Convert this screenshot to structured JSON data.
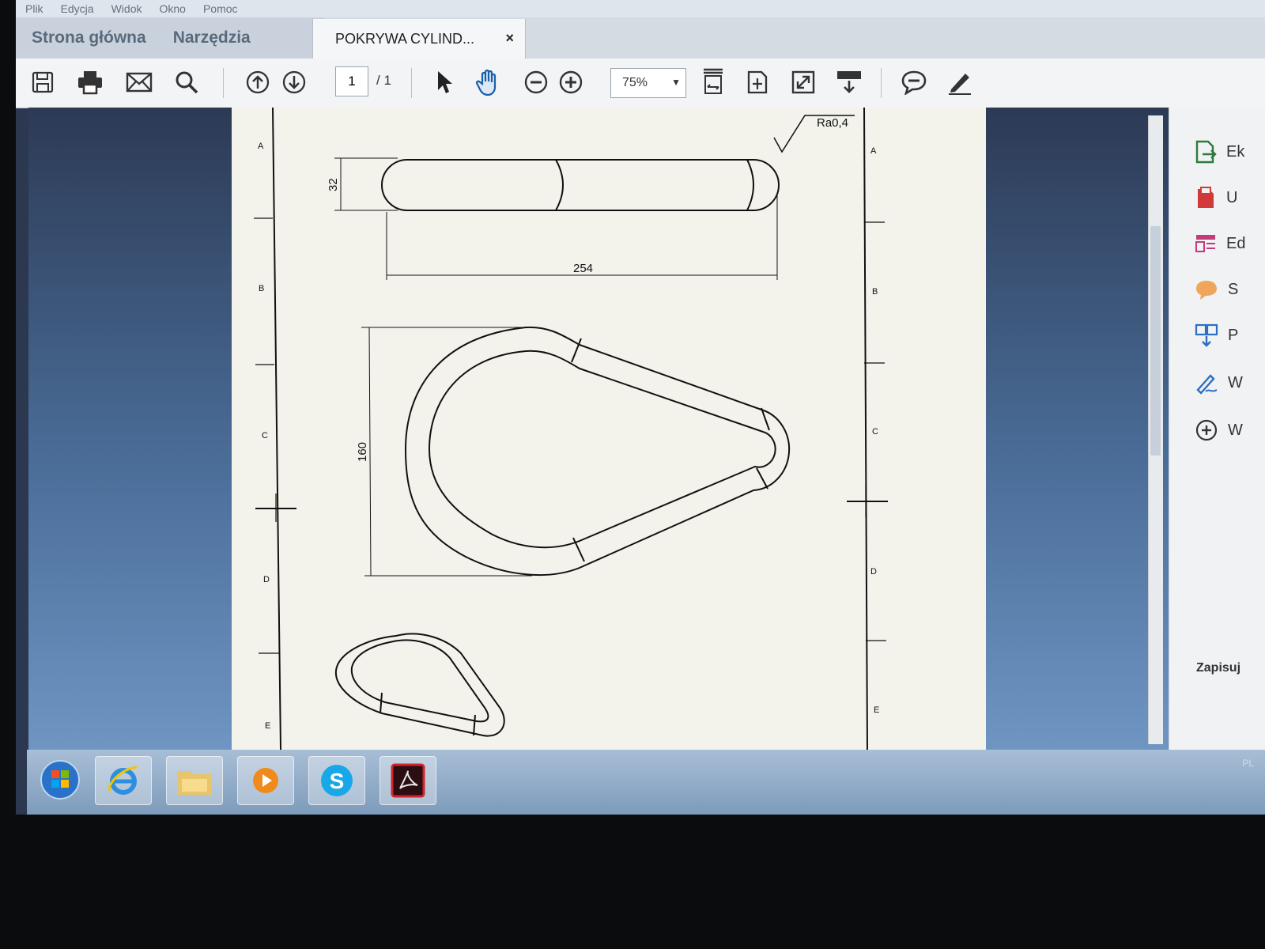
{
  "menu": {
    "items": [
      "Plik",
      "Edycja",
      "Widok",
      "Okno",
      "Pomoc"
    ]
  },
  "nav_tabs": {
    "home": "Strona główna",
    "tools": "Narzędzia"
  },
  "document_tab": {
    "title": "POKRYWA CYLIND...",
    "close": "×"
  },
  "toolbar": {
    "page_current": "1",
    "page_total": "/ 1",
    "zoom": "75%",
    "icons": [
      "save-icon",
      "print-icon",
      "email-icon",
      "search-icon",
      "prev-page-icon",
      "next-page-icon",
      "select-cursor-icon",
      "hand-tool-icon",
      "zoom-out-icon",
      "zoom-in-icon",
      "fit-width-icon",
      "rotate-page-icon",
      "full-screen-icon",
      "read-mode-icon",
      "comment-icon",
      "pen-icon"
    ]
  },
  "drawing": {
    "surface_finish": "Ra0,4",
    "dim_height_top": "32",
    "dim_length": "254",
    "dim_height_front": "160",
    "row_labels": [
      "A",
      "B",
      "C",
      "D",
      "E"
    ]
  },
  "right_pane": {
    "items": [
      {
        "label": "Ek",
        "icon": "export-pdf-icon"
      },
      {
        "label": "U",
        "icon": "create-pdf-icon"
      },
      {
        "label": "Ed",
        "icon": "edit-pdf-icon"
      },
      {
        "label": "S",
        "icon": "comment-bubble-icon"
      },
      {
        "label": "P",
        "icon": "combine-files-icon"
      },
      {
        "label": "W",
        "icon": "fill-sign-icon"
      },
      {
        "label": "W",
        "icon": "more-tools-icon"
      }
    ],
    "save_label": "Zapisuj"
  },
  "taskbar": {
    "apps": [
      "start-orb-icon",
      "internet-explorer-icon",
      "file-explorer-icon",
      "media-player-icon",
      "skype-icon",
      "acrobat-reader-icon"
    ],
    "tray_text": "PL"
  },
  "colors": {
    "accent": "#1a5fa8",
    "page": "#f3f3ec",
    "taskbar": "#8eaac8"
  }
}
